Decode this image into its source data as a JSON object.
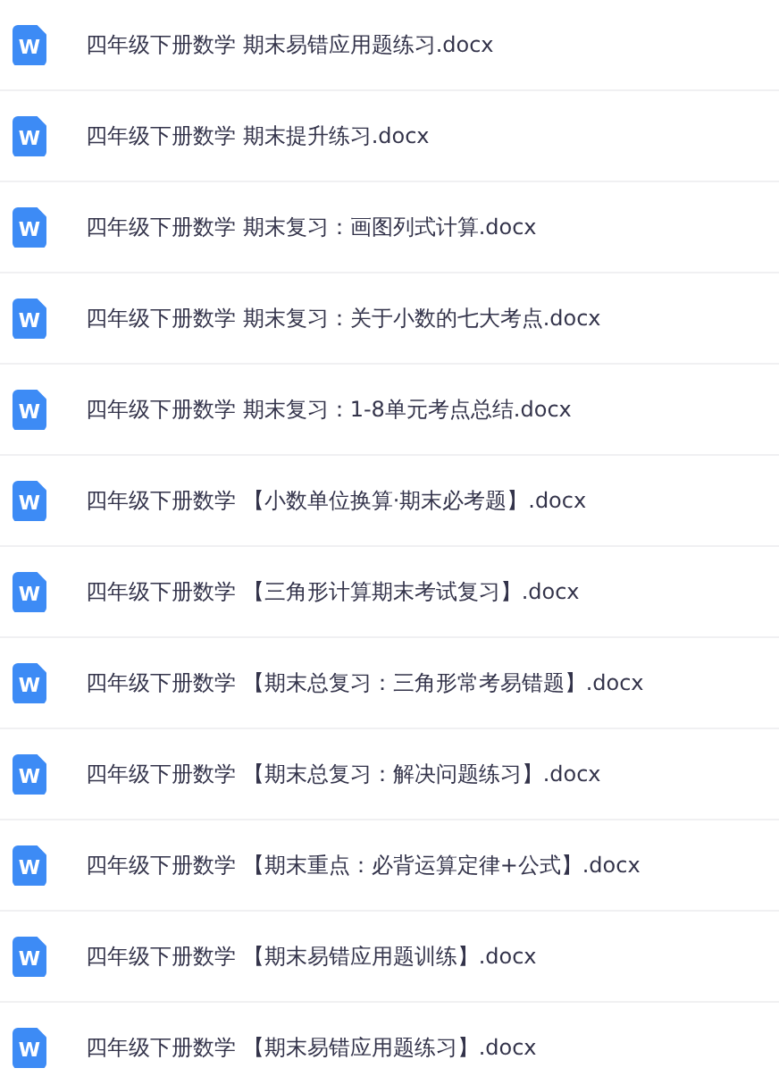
{
  "files": [
    {
      "icon_label": "W",
      "name": "四年级下册数学 期末易错应用题练习.docx"
    },
    {
      "icon_label": "W",
      "name": "四年级下册数学 期末提升练习.docx"
    },
    {
      "icon_label": "W",
      "name": "四年级下册数学 期末复习：画图列式计算.docx"
    },
    {
      "icon_label": "W",
      "name": "四年级下册数学 期末复习：关于小数的七大考点.docx"
    },
    {
      "icon_label": "W",
      "name": "四年级下册数学 期末复习：1-8单元考点总结.docx"
    },
    {
      "icon_label": "W",
      "name": "四年级下册数学 【小数单位换算·期末必考题】.docx"
    },
    {
      "icon_label": "W",
      "name": "四年级下册数学 【三角形计算期末考试复习】.docx"
    },
    {
      "icon_label": "W",
      "name": "四年级下册数学 【期末总复习：三角形常考易错题】.docx"
    },
    {
      "icon_label": "W",
      "name": "四年级下册数学 【期末总复习：解决问题练习】.docx"
    },
    {
      "icon_label": "W",
      "name": "四年级下册数学 【期末重点：必背运算定律+公式】.docx"
    },
    {
      "icon_label": "W",
      "name": "四年级下册数学 【期末易错应用题训练】.docx"
    },
    {
      "icon_label": "W",
      "name": "四年级下册数学 【期末易错应用题练习】.docx"
    }
  ]
}
